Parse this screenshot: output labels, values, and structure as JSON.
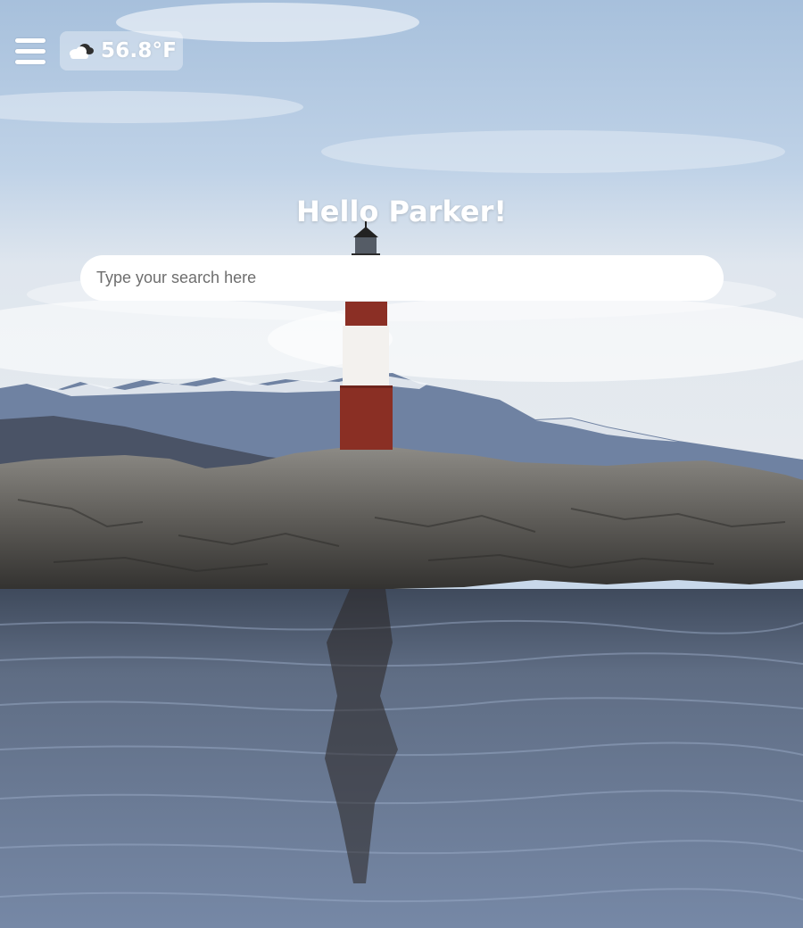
{
  "header": {
    "menu_icon": "hamburger-menu-icon",
    "weather": {
      "icon": "partly-cloudy-icon",
      "temperature": "56.8°F"
    }
  },
  "main": {
    "greeting": "Hello Parker!",
    "search": {
      "placeholder": "Type your search here",
      "value": ""
    }
  },
  "background": {
    "icon": "lighthouse-landscape-photo"
  }
}
